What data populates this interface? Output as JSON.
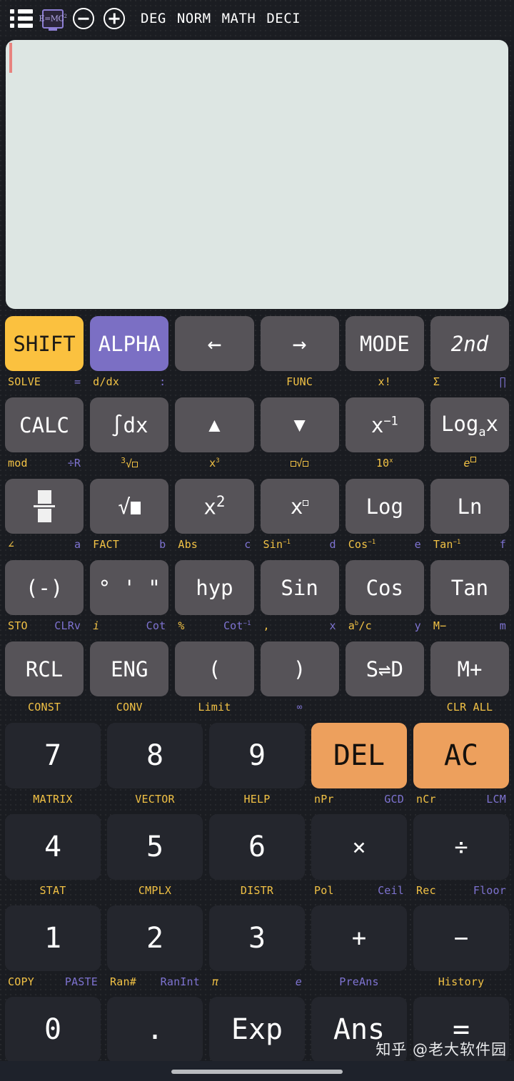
{
  "app": {
    "title": "Scientific Calculator",
    "accent_amber": "#fbc13f",
    "accent_purple": "#7b6fc4",
    "accent_orange": "#eda05d",
    "display_bg": "#dde6e3",
    "key_bg": "#565358",
    "numkey_bg": "#24262d"
  },
  "topbar": {
    "menu_icon": "list-menu-icon",
    "formula_icon": "emc2-icon",
    "formula_text": "E=MC",
    "formula_exp": "2",
    "zoom_out_icon": "minus-circle-icon",
    "zoom_in_icon": "plus-circle-icon",
    "flags": [
      "DEG",
      "NORM",
      "MATH",
      "DECI"
    ]
  },
  "display": {
    "value": "",
    "cursor_color": "#e8837f"
  },
  "keypad": {
    "rows": [
      {
        "type": "fn",
        "keys": [
          {
            "label": "SHIFT",
            "style": "shift",
            "sub_left": "SOLVE",
            "sub_right": "="
          },
          {
            "label": "ALPHA",
            "style": "alpha",
            "sub_left": "d/dx",
            "sub_right": ":"
          },
          {
            "label": "←",
            "style": "dark",
            "sub_left": "",
            "sub_right": ""
          },
          {
            "label": "→",
            "style": "dark",
            "sub_left": "FUNC",
            "sub_right": ""
          },
          {
            "label": "MODE",
            "style": "dark",
            "sub_left": "x!",
            "sub_right": ""
          },
          {
            "label": "2nd",
            "style": "dark",
            "sub_left": "Σ",
            "sub_right": "∏"
          }
        ]
      },
      {
        "type": "fn",
        "keys": [
          {
            "label": "CALC",
            "style": "dark",
            "sub_left": "mod",
            "sub_right": "÷R"
          },
          {
            "label": "∫dx",
            "style": "dark",
            "sub_left": "³√□",
            "sub_right": ""
          },
          {
            "label": "▲",
            "style": "dark",
            "sub_left": "x³",
            "sub_right": ""
          },
          {
            "label": "▼",
            "style": "dark",
            "sub_left": "□√□",
            "sub_right": ""
          },
          {
            "label": "x⁻¹",
            "style": "dark",
            "sub_left": "10ˣ",
            "sub_right": ""
          },
          {
            "label": "Logₐx",
            "style": "dark",
            "sub_left": "e□",
            "sub_right": ""
          }
        ]
      },
      {
        "type": "fn",
        "keys": [
          {
            "label": "□/□",
            "style": "dark",
            "sub_left": "∠",
            "sub_right": "a"
          },
          {
            "label": "√□",
            "style": "dark",
            "sub_left": "FACT",
            "sub_right": "b"
          },
          {
            "label": "x²",
            "style": "dark",
            "sub_left": "Abs",
            "sub_right": "c"
          },
          {
            "label": "x□",
            "style": "dark",
            "sub_left": "Sin⁻¹",
            "sub_right": "d"
          },
          {
            "label": "Log",
            "style": "dark",
            "sub_left": "Cos⁻¹",
            "sub_right": "e"
          },
          {
            "label": "Ln",
            "style": "dark",
            "sub_left": "Tan⁻¹",
            "sub_right": "f"
          }
        ]
      },
      {
        "type": "fn",
        "keys": [
          {
            "label": "(-)",
            "style": "dark",
            "sub_left": "STO",
            "sub_right": "CLRv"
          },
          {
            "label": "° ' \"",
            "style": "dark",
            "sub_left": "i",
            "sub_right": "Cot"
          },
          {
            "label": "hyp",
            "style": "dark",
            "sub_left": "%",
            "sub_right": "Cot⁻¹"
          },
          {
            "label": "Sin",
            "style": "dark",
            "sub_left": ",",
            "sub_right": "x"
          },
          {
            "label": "Cos",
            "style": "dark",
            "sub_left": "aᵇ/c",
            "sub_right": "y"
          },
          {
            "label": "Tan",
            "style": "dark",
            "sub_left": "M−",
            "sub_right": "m"
          }
        ]
      },
      {
        "type": "fn",
        "keys": [
          {
            "label": "RCL",
            "style": "dark",
            "sub_left": "CONST",
            "sub_right": ""
          },
          {
            "label": "ENG",
            "style": "dark",
            "sub_left": "CONV",
            "sub_right": ""
          },
          {
            "label": "(",
            "style": "dark",
            "sub_left": "Limit",
            "sub_right": ""
          },
          {
            "label": ")",
            "style": "dark",
            "sub_left": "∞",
            "sub_right": ""
          },
          {
            "label": "S⇌D",
            "style": "dark",
            "sub_left": "",
            "sub_right": ""
          },
          {
            "label": "M+",
            "style": "dark",
            "sub_left": "CLR ALL",
            "sub_right": ""
          }
        ]
      },
      {
        "type": "num",
        "keys": [
          {
            "label": "7",
            "style": "numk",
            "sub_left": "MATRIX",
            "sub_right": ""
          },
          {
            "label": "8",
            "style": "numk",
            "sub_left": "VECTOR",
            "sub_right": ""
          },
          {
            "label": "9",
            "style": "numk",
            "sub_left": "HELP",
            "sub_right": ""
          },
          {
            "label": "DEL",
            "style": "orange",
            "sub_left": "nPr",
            "sub_right": "GCD"
          },
          {
            "label": "AC",
            "style": "orange",
            "sub_left": "nCr",
            "sub_right": "LCM"
          }
        ]
      },
      {
        "type": "num",
        "keys": [
          {
            "label": "4",
            "style": "numk",
            "sub_left": "STAT",
            "sub_right": ""
          },
          {
            "label": "5",
            "style": "numk",
            "sub_left": "CMPLX",
            "sub_right": ""
          },
          {
            "label": "6",
            "style": "numk",
            "sub_left": "DISTR",
            "sub_right": ""
          },
          {
            "label": "×",
            "style": "numk",
            "sub_left": "Pol",
            "sub_right": "Ceil"
          },
          {
            "label": "÷",
            "style": "numk",
            "sub_left": "Rec",
            "sub_right": "Floor"
          }
        ]
      },
      {
        "type": "num",
        "keys": [
          {
            "label": "1",
            "style": "numk",
            "sub_left": "COPY",
            "sub_right": "PASTE"
          },
          {
            "label": "2",
            "style": "numk",
            "sub_left": "Ran#",
            "sub_right": "RanInt"
          },
          {
            "label": "3",
            "style": "numk",
            "sub_left": "π",
            "sub_right": "e"
          },
          {
            "label": "+",
            "style": "numk",
            "sub_left": "",
            "sub_right": "PreAns"
          },
          {
            "label": "−",
            "style": "numk",
            "sub_left": "History",
            "sub_right": ""
          }
        ]
      },
      {
        "type": "last",
        "keys": [
          {
            "label": "0",
            "style": "numk",
            "sub_left": "",
            "sub_right": ""
          },
          {
            "label": ".",
            "style": "numk",
            "sub_left": "",
            "sub_right": ""
          },
          {
            "label": "Exp",
            "style": "numk",
            "sub_left": "",
            "sub_right": ""
          },
          {
            "label": "Ans",
            "style": "numk",
            "sub_left": "",
            "sub_right": ""
          },
          {
            "label": "=",
            "style": "numk",
            "sub_left": "",
            "sub_right": ""
          }
        ]
      }
    ]
  },
  "footer": {
    "watermark": "知乎 @老大软件园",
    "home_indicator": "home-indicator"
  }
}
